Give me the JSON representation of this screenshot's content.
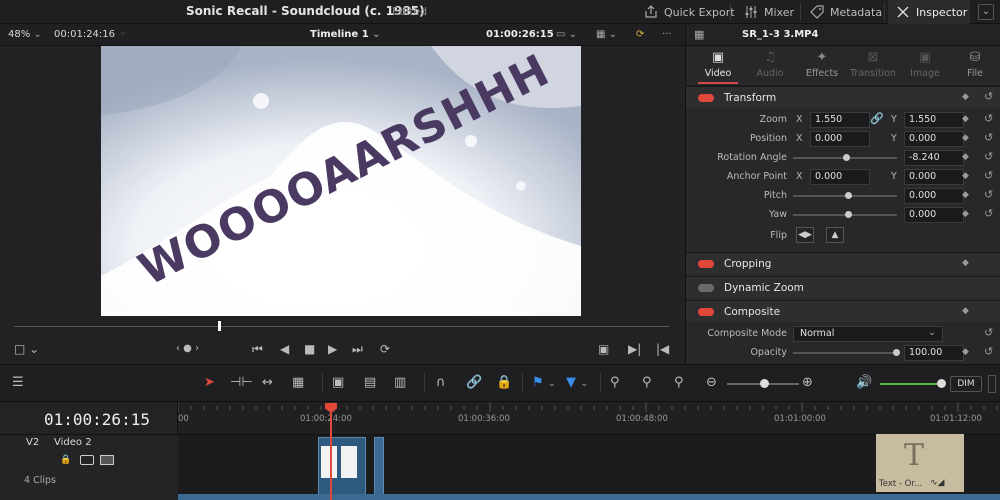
{
  "titlebar": {
    "project_title": "Sonic Recall - Soundcloud (c. 1985)",
    "status": "Edited",
    "buttons": [
      "Quick Export",
      "Mixer",
      "Metadata",
      "Inspector"
    ]
  },
  "viewer": {
    "zoom": "48%",
    "source_timecode": "00:01:24:16",
    "timeline_name": "Timeline 1",
    "record_timecode": "01:00:26:15",
    "frame_text": "WOOOOAARSHHH"
  },
  "inspector": {
    "clip_name": "SR_1-3 3.MP4",
    "tabs": [
      "Video",
      "Audio",
      "Effects",
      "Transition",
      "Image",
      "File"
    ],
    "active_tab": "Video",
    "transform": {
      "label": "Transform",
      "zoom_label": "Zoom",
      "zoom_x": "1.550",
      "zoom_y": "1.550",
      "position_label": "Position",
      "position_x": "0.000",
      "position_y": "0.000",
      "rotation_label": "Rotation Angle",
      "rotation_value": "-8.240",
      "anchor_label": "Anchor Point",
      "anchor_x": "0.000",
      "anchor_y": "0.000",
      "pitch_label": "Pitch",
      "pitch_value": "0.000",
      "yaw_label": "Yaw",
      "yaw_value": "0.000",
      "flip_label": "Flip",
      "x_axis": "X",
      "y_axis": "Y"
    },
    "cropping": "Cropping",
    "dynamic_zoom": "Dynamic Zoom",
    "composite": {
      "label": "Composite",
      "mode_label": "Composite Mode",
      "mode_value": "Normal",
      "opacity_label": "Opacity",
      "opacity_value": "100.00"
    },
    "accent": "#e2483a"
  },
  "timeline": {
    "timecode": "01:00:26:15",
    "track_id": "V2",
    "track_name": "Video 2",
    "clip_count": "4 Clips",
    "ruler": [
      "00",
      "01:00:24:00",
      "01:00:36:00",
      "01:00:48:00",
      "01:01:00:00",
      "01:01:12:00"
    ],
    "title_clip_label": "Text - Or...",
    "dim_label": "DIM"
  }
}
